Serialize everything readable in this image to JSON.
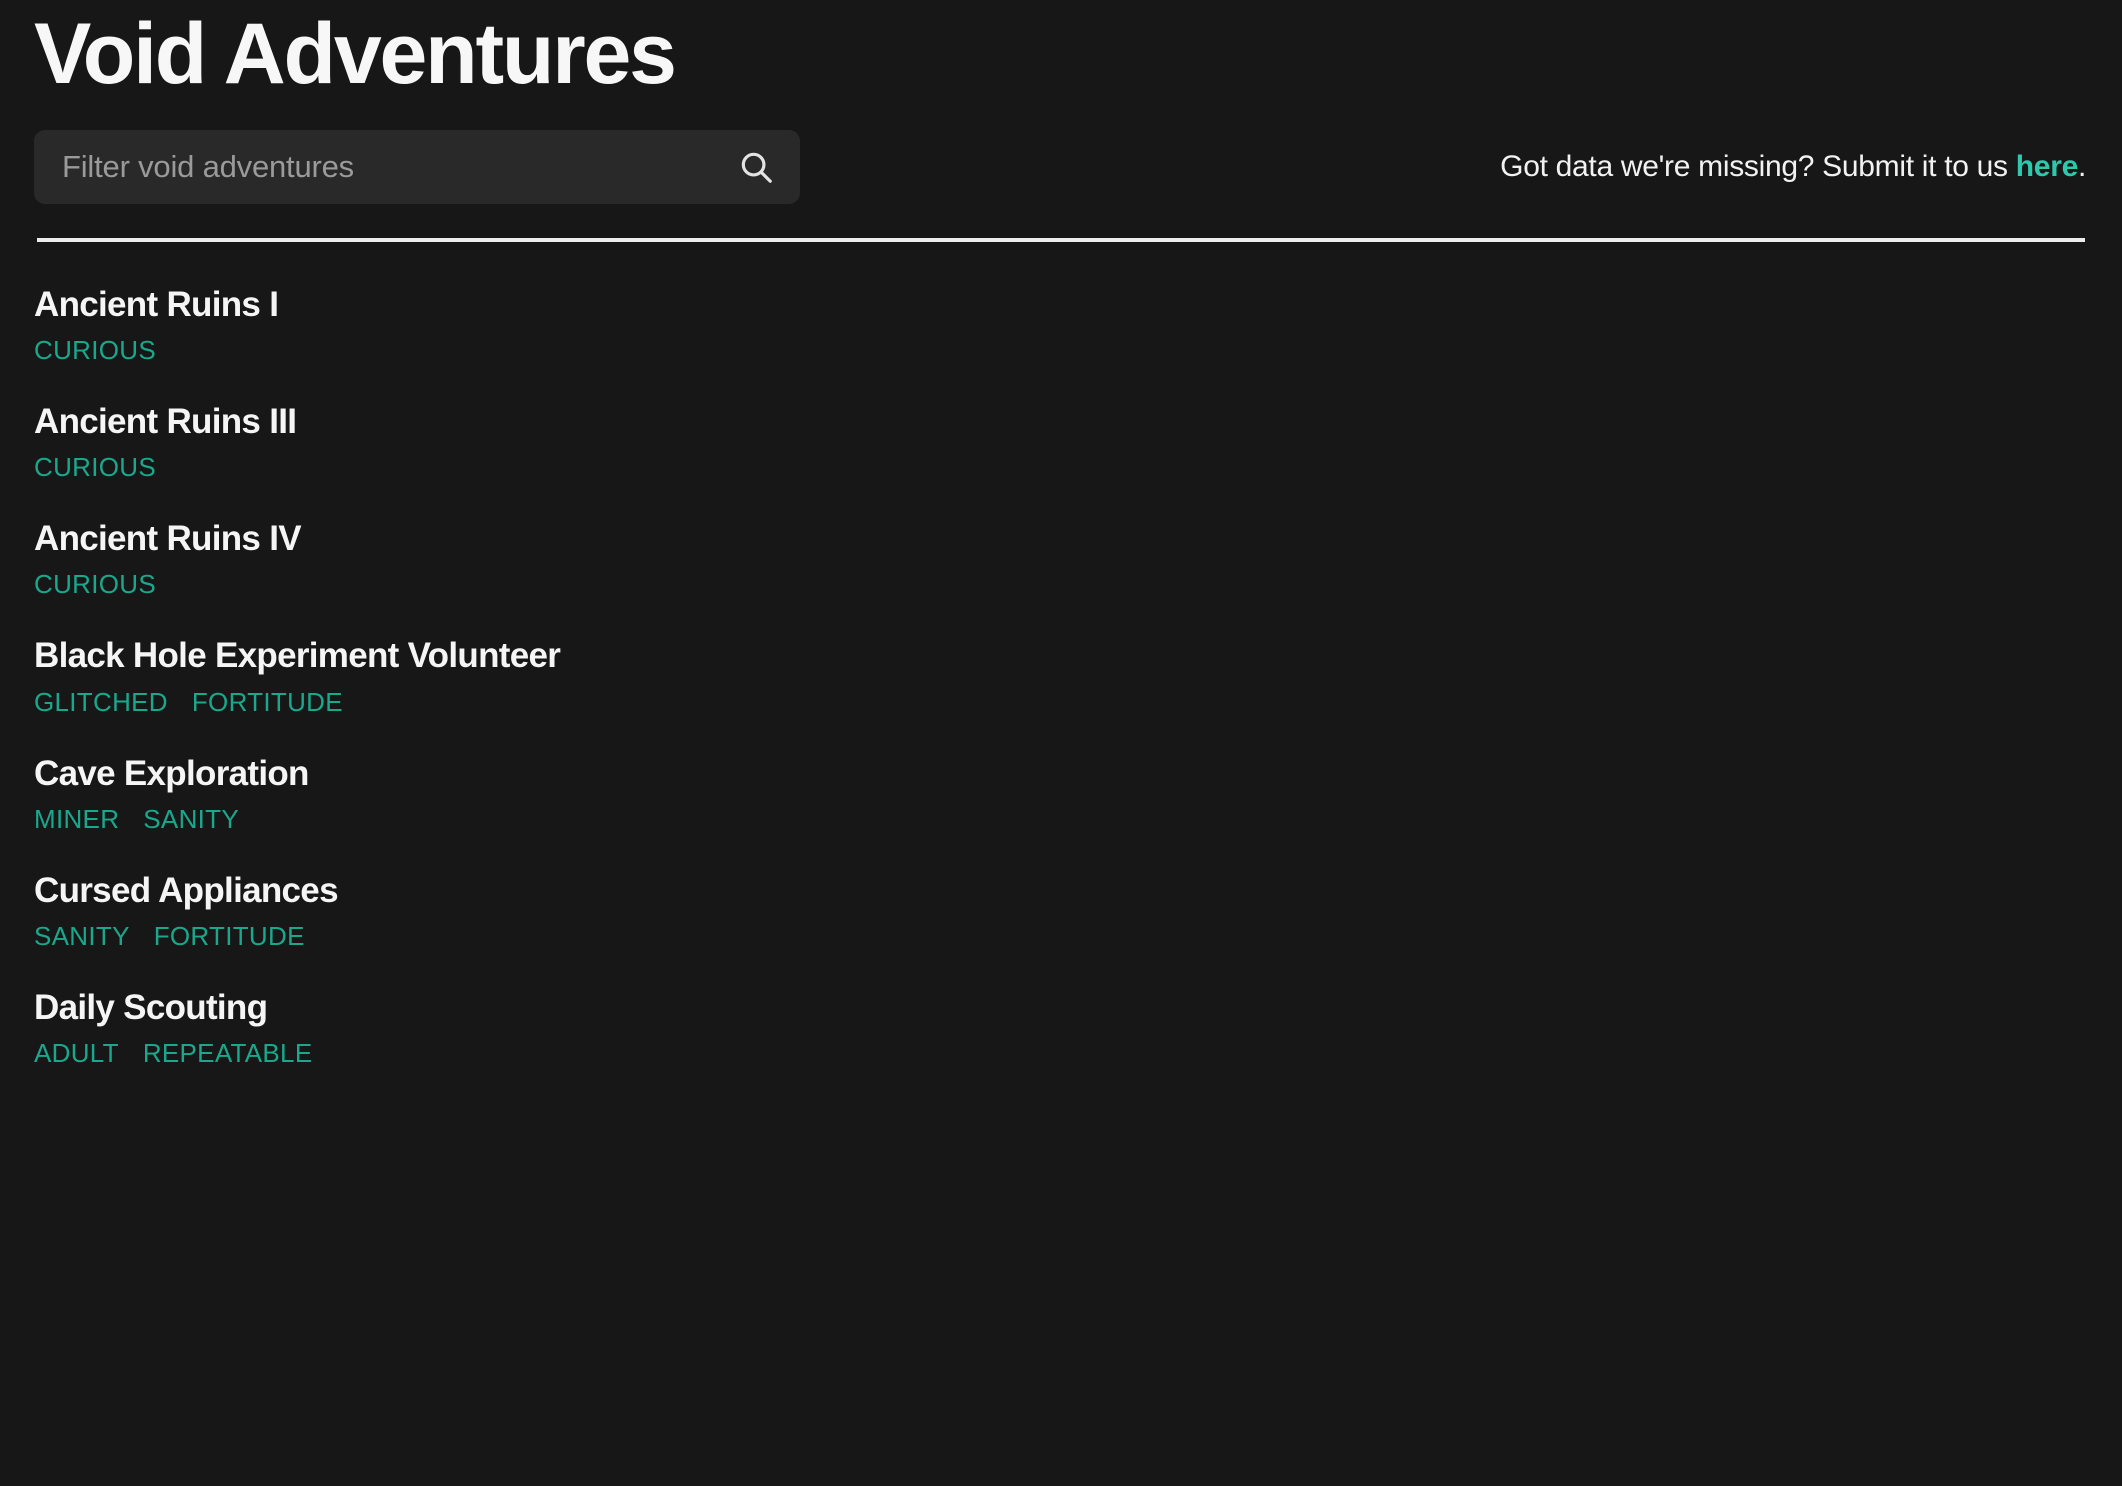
{
  "header": {
    "title": "Void Adventures",
    "search": {
      "placeholder": "Filter void adventures",
      "value": "",
      "icon": "search-icon"
    },
    "submit_note": {
      "text_before": "Got data we're missing? Submit it to us ",
      "link_label": "here",
      "text_after": "."
    }
  },
  "theme": {
    "background": "#171717",
    "search_background": "#292929",
    "divider": "#ededed",
    "tag_color": "#1aa88d",
    "link_color": "#2ec9ad",
    "title_color": "#f5f5f5"
  },
  "list": {
    "items": [
      {
        "name": "Ancient Ruins I",
        "tags": [
          "CURIOUS"
        ]
      },
      {
        "name": "Ancient Ruins III",
        "tags": [
          "CURIOUS"
        ]
      },
      {
        "name": "Ancient Ruins IV",
        "tags": [
          "CURIOUS"
        ]
      },
      {
        "name": "Black Hole Experiment Volunteer",
        "tags": [
          "GLITCHED",
          "FORTITUDE"
        ]
      },
      {
        "name": "Cave Exploration",
        "tags": [
          "MINER",
          "SANITY"
        ]
      },
      {
        "name": "Cursed Appliances",
        "tags": [
          "SANITY",
          "FORTITUDE"
        ]
      },
      {
        "name": "Daily Scouting",
        "tags": [
          "ADULT",
          "REPEATABLE"
        ]
      }
    ]
  }
}
